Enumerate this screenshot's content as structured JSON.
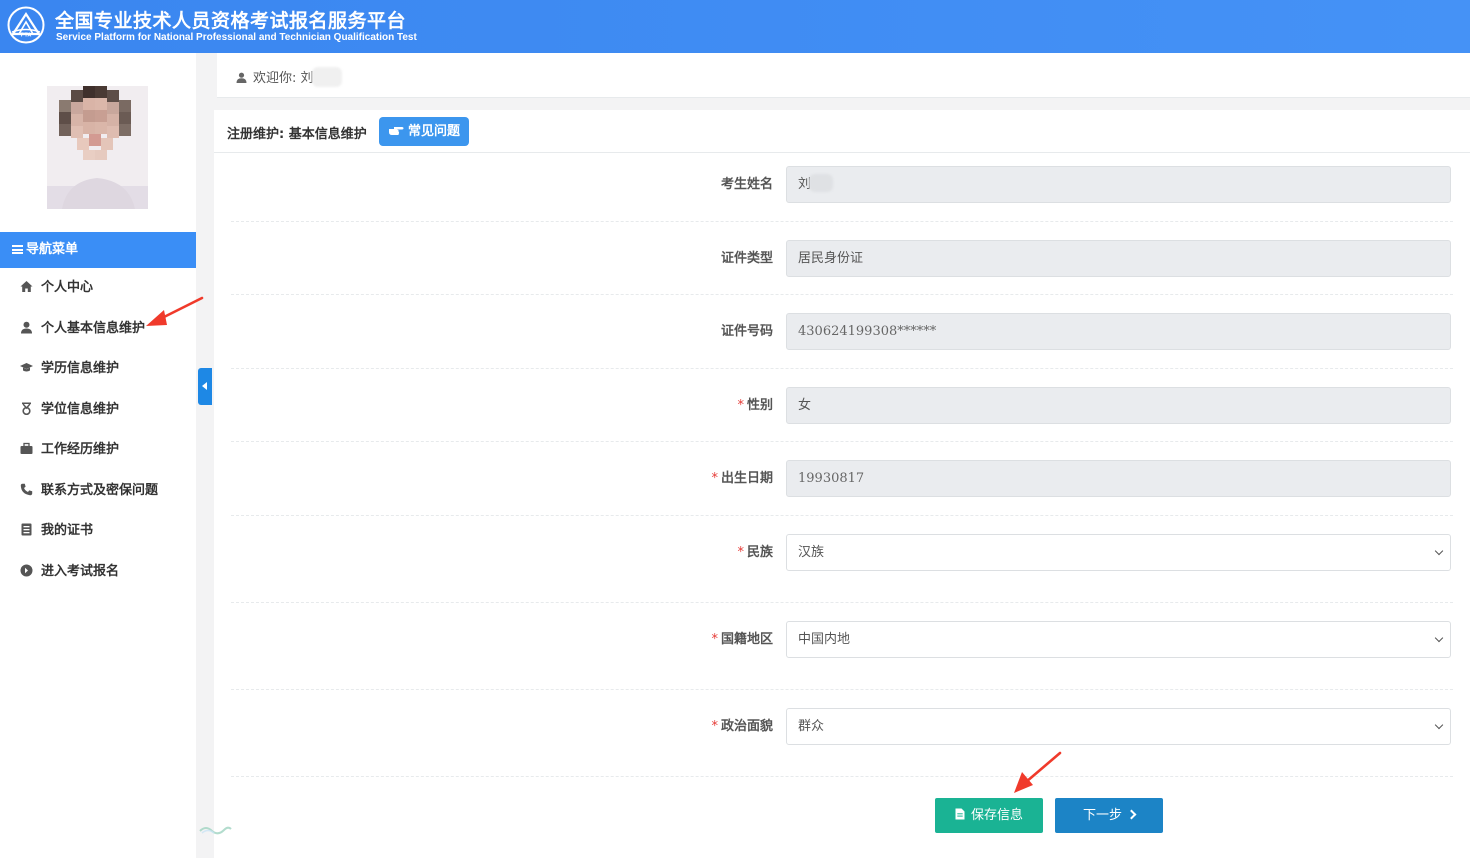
{
  "header": {
    "title": "全国专业技术人员资格考试报名服务平台",
    "subtitle": "Service Platform for National Professional and Technician Qualification Test"
  },
  "sidebar": {
    "nav_title": "导航菜单",
    "items": [
      {
        "label": "个人中心",
        "icon": "home-icon"
      },
      {
        "label": "个人基本信息维护",
        "icon": "user-icon"
      },
      {
        "label": "学历信息维护",
        "icon": "graduation-cap-icon"
      },
      {
        "label": "学位信息维护",
        "icon": "medal-icon"
      },
      {
        "label": "工作经历维护",
        "icon": "briefcase-icon"
      },
      {
        "label": "联系方式及密保问题",
        "icon": "phone-icon"
      },
      {
        "label": "我的证书",
        "icon": "certificate-icon"
      },
      {
        "label": "进入考试报名",
        "icon": "arrow-circle-icon"
      }
    ]
  },
  "welcome": {
    "text": "欢迎你: 刘"
  },
  "panel": {
    "breadcrumb": "注册维护: 基本信息维护",
    "faq_label": "常见问题"
  },
  "form": {
    "fields": [
      {
        "label": "考生姓名",
        "required": false,
        "value": "刘",
        "kind": "readonly"
      },
      {
        "label": "证件类型",
        "required": false,
        "value": "居民身份证",
        "kind": "readonly"
      },
      {
        "label": "证件号码",
        "required": false,
        "value": "430624199308******",
        "kind": "readonly"
      },
      {
        "label": "性别",
        "required": true,
        "value": "女",
        "kind": "readonly"
      },
      {
        "label": "出生日期",
        "required": true,
        "value": "19930817",
        "kind": "readonly"
      },
      {
        "label": "民族",
        "required": true,
        "value": "汉族",
        "kind": "select"
      },
      {
        "label": "国籍地区",
        "required": true,
        "value": "中国内地",
        "kind": "select"
      },
      {
        "label": "政治面貌",
        "required": true,
        "value": "群众",
        "kind": "select"
      }
    ],
    "required_mark": "*"
  },
  "actions": {
    "save_label": "保存信息",
    "next_label": "下一步"
  },
  "colors": {
    "header": "#3e8ef7",
    "nav_active": "#3a8ef6",
    "save_button": "#1ab394",
    "next_button": "#1c84c6",
    "annotation_arrow": "#f03a2b"
  }
}
